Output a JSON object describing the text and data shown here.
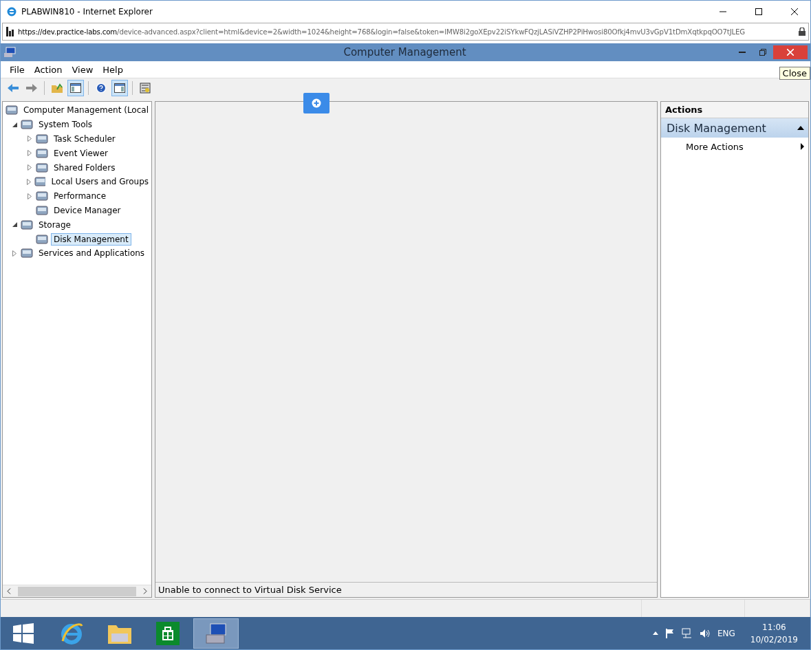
{
  "browser": {
    "title": "PLABWIN810 - Internet Explorer",
    "url_host": "https://dev.practice-labs.com",
    "url_path": "/device-advanced.aspx?client=html&device=2&width=1024&height=768&login=false&token=IMW8i2goXEpv22iSYkwFQzjLASiVZHP2PiHwosi80Ofkj4mvU3vGpV1tDmXqtkpqOO7tJLEG"
  },
  "window": {
    "title": "Computer Management",
    "tooltip": "Close"
  },
  "menu": [
    "File",
    "Action",
    "View",
    "Help"
  ],
  "toolbar": [
    {
      "buttons": [
        {
          "kind": "back",
          "pressed": false
        },
        {
          "kind": "forward",
          "pressed": false
        }
      ]
    },
    {
      "buttons": [
        {
          "kind": "up",
          "pressed": false
        },
        {
          "kind": "tree",
          "pressed": true
        }
      ]
    },
    {
      "buttons": [
        {
          "kind": "help",
          "pressed": false
        },
        {
          "kind": "pane",
          "pressed": true
        }
      ]
    },
    {
      "buttons": [
        {
          "kind": "props",
          "pressed": false
        }
      ]
    }
  ],
  "tree": [
    {
      "label": "Computer Management (Local",
      "selected": false,
      "children": [
        {
          "label": "System Tools",
          "expanded": true,
          "selected": false,
          "children": [
            {
              "label": "Task Scheduler",
              "expanded": false,
              "selected": false
            },
            {
              "label": "Event Viewer",
              "expanded": false,
              "selected": false
            },
            {
              "label": "Shared Folders",
              "expanded": false,
              "selected": false
            },
            {
              "label": "Local Users and Groups",
              "expanded": false,
              "selected": false
            },
            {
              "label": "Performance",
              "expanded": false,
              "selected": false
            },
            {
              "label": "Device Manager",
              "selected": false
            }
          ]
        },
        {
          "label": "Storage",
          "expanded": true,
          "selected": false,
          "children": [
            {
              "label": "Disk Management",
              "selected": true
            }
          ]
        },
        {
          "label": "Services and Applications",
          "expanded": false,
          "selected": false
        }
      ]
    }
  ],
  "status": "Unable to connect to Virtual Disk Service",
  "actions": {
    "header": "Actions",
    "section": "Disk Management",
    "items": [
      "More Actions"
    ]
  },
  "taskbar": {
    "apps": [
      {
        "kind": "ie",
        "selected": false
      },
      {
        "kind": "explorer",
        "selected": false
      },
      {
        "kind": "store",
        "selected": false
      },
      {
        "kind": "mmc",
        "selected": true
      }
    ],
    "language": "ENG",
    "time": "11:06",
    "date": "10/02/2019"
  }
}
